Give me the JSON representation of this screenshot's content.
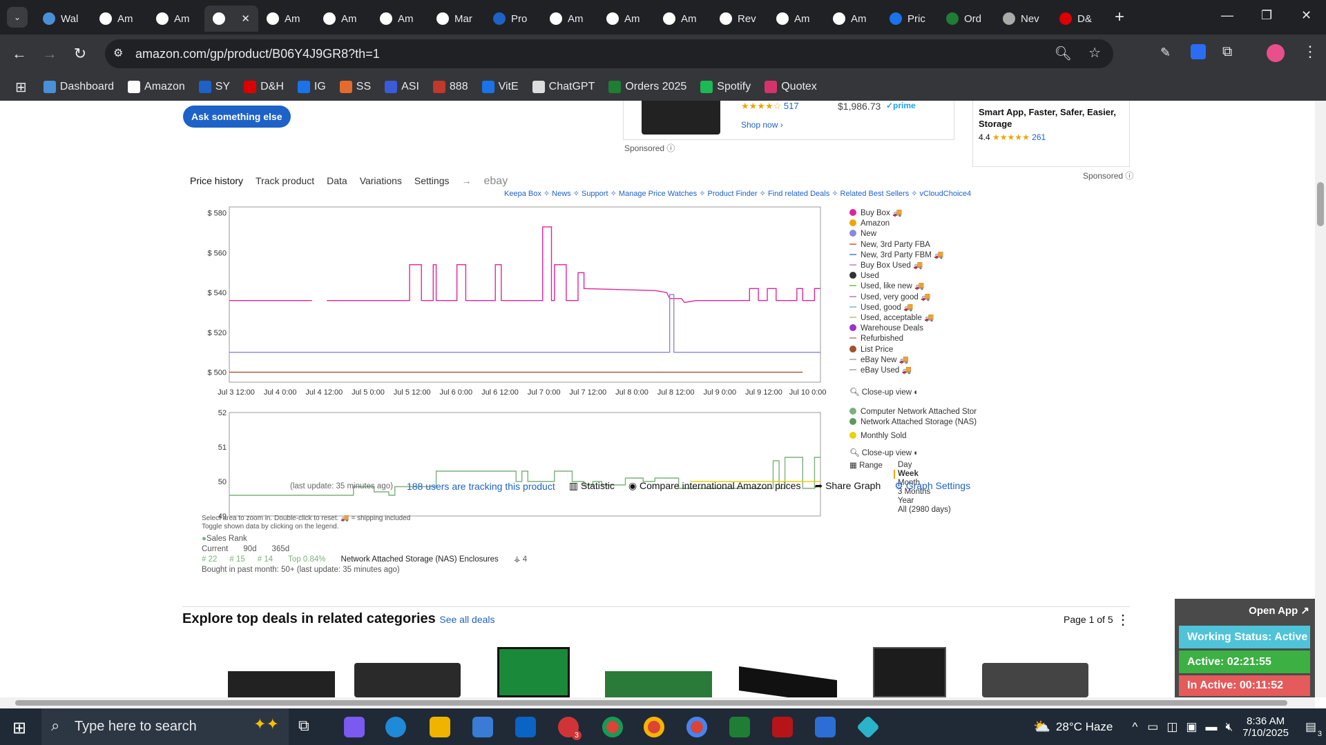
{
  "tabs": [
    {
      "label": "Wal",
      "icon": "walmart-icon",
      "color": "#4a90d9"
    },
    {
      "label": "Am",
      "icon": "amazon-icon",
      "color": "#fff"
    },
    {
      "label": "Am",
      "icon": "amazon-icon",
      "color": "#fff"
    },
    {
      "label": "",
      "icon": "amazon-icon",
      "color": "#fff",
      "active": true
    },
    {
      "label": "Am",
      "icon": "amazon-icon",
      "color": "#fff"
    },
    {
      "label": "Am",
      "icon": "amazon-icon",
      "color": "#fff"
    },
    {
      "label": "Am",
      "icon": "amazon-icon",
      "color": "#fff"
    },
    {
      "label": "Mar",
      "icon": "amazon-icon",
      "color": "#fff"
    },
    {
      "label": "Pro",
      "icon": "ec-icon",
      "color": "#1d62c7"
    },
    {
      "label": "Am",
      "icon": "amazon-icon",
      "color": "#fff"
    },
    {
      "label": "Am",
      "icon": "amazon-icon",
      "color": "#fff"
    },
    {
      "label": "Am",
      "icon": "amazon-icon",
      "color": "#fff"
    },
    {
      "label": "Rev",
      "icon": "amazon-icon",
      "color": "#fff"
    },
    {
      "label": "Am",
      "icon": "amazon-icon",
      "color": "#fff"
    },
    {
      "label": "Am",
      "icon": "amazon-icon",
      "color": "#fff"
    },
    {
      "label": "Pric",
      "icon": "dollar-icon",
      "color": "#1a73e8"
    },
    {
      "label": "Ord",
      "icon": "excel-icon",
      "color": "#1e7e34"
    },
    {
      "label": "Nev",
      "icon": "chrome-icon",
      "color": "#aaa"
    },
    {
      "label": "D&",
      "icon": "dh-icon",
      "color": "#d00"
    }
  ],
  "address": "amazon.com/gp/product/B06Y4J9GR8?th=1",
  "bookmarks": [
    {
      "label": "Dashboard",
      "color": "#4a90d9"
    },
    {
      "label": "Amazon",
      "color": "#fff"
    },
    {
      "label": "SY",
      "color": "#1d62c7"
    },
    {
      "label": "D&H",
      "color": "#d00"
    },
    {
      "label": "IG",
      "color": "#1a73e8"
    },
    {
      "label": "SS",
      "color": "#e36b2c"
    },
    {
      "label": "ASI",
      "color": "#3b5bdb"
    },
    {
      "label": "888",
      "color": "#c0392b"
    },
    {
      "label": "VitE",
      "color": "#1a73e8"
    },
    {
      "label": "ChatGPT",
      "color": "#ddd"
    },
    {
      "label": "Orders 2025",
      "color": "#1e7e34"
    },
    {
      "label": "Spotify",
      "color": "#1db954"
    },
    {
      "label": "Quotex",
      "color": "#d6336c"
    }
  ],
  "page": {
    "ask_button": "Ask something else",
    "ad1_rating_count": "517",
    "ad1_price": "$1,986.73",
    "ad1_prime": "✓prime",
    "ad1_shop": "Shop now ›",
    "sponsored": "Sponsored",
    "ad2_title": "Smart App, Faster, Safer, Easier, Storage",
    "ad2_rating": "4.4",
    "ad2_count": "261",
    "keepa_tabs": [
      "Price history",
      "Track product",
      "Data",
      "Variations",
      "Settings"
    ],
    "arrow": "→",
    "ebay": "ebay",
    "keepa_links": "Keepa Box ✧ News ✧ Support ✧ Manage Price Watches ✧ Product Finder ✧ Find related Deals ✧ Related Best Sellers ✧ vCloudChoice4",
    "price_legend": [
      {
        "label": "Buy Box",
        "kind": "dot",
        "color": "#e0249a",
        "truck": true
      },
      {
        "label": "Amazon",
        "kind": "dot",
        "color": "#f0a500"
      },
      {
        "label": "New",
        "kind": "dot",
        "color": "#8888dd"
      },
      {
        "label": "New, 3rd Party FBA",
        "kind": "line",
        "color": "#e08060"
      },
      {
        "label": "New, 3rd Party FBM",
        "kind": "line",
        "color": "#6aa0e0",
        "truck": true
      },
      {
        "label": "Buy Box Used",
        "kind": "line",
        "color": "#d0a0d0",
        "truck": true
      },
      {
        "label": "Used",
        "kind": "dot",
        "color": "#333"
      },
      {
        "label": "Used, like new",
        "kind": "line",
        "color": "#9c6",
        "truck": true
      },
      {
        "label": "Used, very good",
        "kind": "line",
        "color": "#c9c",
        "truck": true
      },
      {
        "label": "Used, good",
        "kind": "line",
        "color": "#9cc",
        "truck": true
      },
      {
        "label": "Used, acceptable",
        "kind": "line",
        "color": "#cc9",
        "truck": true
      },
      {
        "label": "Warehouse Deals",
        "kind": "dot",
        "color": "#9933cc"
      },
      {
        "label": "Refurbished",
        "kind": "line",
        "color": "#c99"
      },
      {
        "label": "List Price",
        "kind": "dot",
        "color": "#a0522d"
      },
      {
        "label": "eBay New",
        "kind": "line",
        "color": "#bbb",
        "truck": true
      },
      {
        "label": "eBay Used",
        "kind": "line",
        "color": "#bbb",
        "truck": true
      }
    ],
    "closeup": "Close-up view",
    "rank_legend": [
      {
        "label": "Computer Network Attached Stor",
        "color": "#7cb07c"
      },
      {
        "label": "Network Attached Storage (NAS)",
        "color": "#5a9a5a"
      },
      {
        "label": "Monthly Sold",
        "color": "#e8d200"
      }
    ],
    "range_label": "Range",
    "ranges": [
      "Day",
      "Week",
      "Month",
      "3 Months",
      "Year",
      "All (2980 days)"
    ],
    "range_selected": "Week",
    "hint1": "Select area to zoom in. Double-click to reset.",
    "hint_truck": "= shipping included",
    "hint2": "Toggle shown data by clicking on the legend.",
    "sales_rank": "Sales Rank",
    "stats_heads": [
      "Current",
      "90d",
      "365d"
    ],
    "stats_vals": [
      "# 22",
      "# 15",
      "# 14"
    ],
    "top_pct": "Top 0.84%",
    "category": "Network Attached Storage (NAS) Enclosures",
    "cat_count": "4",
    "bought": "Bought in past month: 50+ (last update: 35 minutes ago)",
    "last_update": "(last update: 35 minutes ago)",
    "tracking": "188 users are tracking this product",
    "statistic": "Statistic",
    "compare": "Compare international Amazon prices",
    "share": "Share Graph",
    "graph_settings": "Graph Settings",
    "explore_title": "Explore top deals in related categories",
    "see_all": "See all deals",
    "page_of": "Page 1 of 5"
  },
  "widget": {
    "open_app": "Open App ↗",
    "working": "Working Status: Active",
    "active": "Active: 02:21:55",
    "inactive": "In Active: 00:11:52"
  },
  "taskbar": {
    "search_placeholder": "Type here to search",
    "weather": "28°C  Haze",
    "time": "8:36 AM",
    "date": "7/10/2025",
    "notif_count": "3",
    "outlook_badge": "3"
  },
  "chart_data": [
    {
      "type": "line",
      "title": "",
      "x_ticks": [
        "Jul 3 12:00",
        "Jul 4 0:00",
        "Jul 4 12:00",
        "Jul 5 0:00",
        "Jul 5 12:00",
        "Jul 6 0:00",
        "Jul 6 12:00",
        "Jul 7 0:00",
        "Jul 7 12:00",
        "Jul 8 0:00",
        "Jul 8 12:00",
        "Jul 9 0:00",
        "Jul 9 12:00",
        "Jul 10 0:00"
      ],
      "y_ticks": [
        "$ 580",
        "$ 560",
        "$ 540",
        "$ 520",
        "$ 500"
      ],
      "ylim": [
        495,
        583
      ],
      "xlim": [
        0,
        100
      ],
      "series": [
        {
          "name": "Buy Box",
          "color": "#e0249a",
          "points": [
            [
              0,
              536
            ],
            [
              14,
              536
            ],
            [
              14.5,
              null
            ],
            [
              16.5,
              536
            ],
            [
              30.5,
              536
            ],
            [
              30.5,
              554
            ],
            [
              32.5,
              554
            ],
            [
              32.5,
              536
            ],
            [
              34.5,
              536
            ],
            [
              34.5,
              554
            ],
            [
              35,
              554
            ],
            [
              35,
              536
            ],
            [
              38.5,
              536
            ],
            [
              38.5,
              554
            ],
            [
              40,
              554
            ],
            [
              40,
              536
            ],
            [
              45,
              536
            ],
            [
              45,
              554
            ],
            [
              46,
              554
            ],
            [
              46,
              536
            ],
            [
              53,
              536
            ],
            [
              53,
              573
            ],
            [
              54.5,
              573
            ],
            [
              54.5,
              536
            ],
            [
              55,
              536
            ],
            [
              55,
              554
            ],
            [
              57,
              554
            ],
            [
              57,
              536
            ],
            [
              59,
              536
            ],
            [
              59,
              550
            ],
            [
              60,
              550
            ],
            [
              60,
              542
            ],
            [
              72,
              541
            ],
            [
              74,
              540
            ],
            [
              74.5,
              537
            ],
            [
              76.5,
              537
            ],
            [
              77,
              535
            ],
            [
              79,
              536
            ],
            [
              88,
              536
            ],
            [
              88,
              542
            ],
            [
              89.5,
              542
            ],
            [
              89.5,
              536
            ],
            [
              91,
              536
            ],
            [
              91,
              542
            ],
            [
              92.5,
              542
            ],
            [
              92.5,
              536
            ],
            [
              96,
              536
            ],
            [
              96,
              542
            ],
            [
              97,
              542
            ],
            [
              97,
              536
            ],
            [
              99,
              536
            ],
            [
              99,
              542
            ],
            [
              100,
              542
            ]
          ]
        },
        {
          "name": "New",
          "color": "#8888dd",
          "points": [
            [
              0,
              510
            ],
            [
              74.5,
              510
            ],
            [
              74.5,
              539
            ],
            [
              75.2,
              539
            ],
            [
              75.2,
              510
            ],
            [
              100,
              510
            ]
          ]
        },
        {
          "name": "List Price",
          "color": "#a0522d",
          "points": [
            [
              0,
              500
            ],
            [
              97,
              500
            ]
          ]
        }
      ]
    },
    {
      "type": "line",
      "title": "",
      "y_ticks": [
        "52",
        "51",
        "50",
        "49"
      ],
      "ylim": [
        49,
        52
      ],
      "xlim": [
        0,
        100
      ],
      "series": [
        {
          "name": "Network Attached Storage (NAS)",
          "color": "#7cb07c",
          "points": [
            [
              0,
              49.6
            ],
            [
              21,
              49.6
            ],
            [
              21,
              49.85
            ],
            [
              24.5,
              49.85
            ],
            [
              24.5,
              49.7
            ],
            [
              27,
              49.7
            ],
            [
              27,
              49.6
            ],
            [
              28,
              49.6
            ],
            [
              28,
              49.85
            ],
            [
              35,
              49.85
            ],
            [
              35,
              50.3
            ],
            [
              48.5,
              50.3
            ],
            [
              48.5,
              50
            ],
            [
              49.5,
              50
            ],
            [
              49.5,
              50.3
            ],
            [
              50.5,
              50.3
            ],
            [
              50.5,
              50
            ],
            [
              55,
              50
            ],
            [
              55,
              50.3
            ],
            [
              58,
              50.3
            ],
            [
              58,
              50
            ],
            [
              60,
              50
            ],
            [
              60,
              49.9
            ],
            [
              61.5,
              49.9
            ],
            [
              61.5,
              50
            ],
            [
              63,
              50
            ],
            [
              63,
              49.9
            ],
            [
              67,
              49.9
            ],
            [
              67,
              50.1
            ],
            [
              70,
              50.1
            ],
            [
              70,
              50
            ],
            [
              72,
              50
            ],
            [
              72,
              50.1
            ],
            [
              76,
              50.1
            ],
            [
              76,
              49.8
            ],
            [
              92,
              49.8
            ],
            [
              92,
              50.6
            ],
            [
              93,
              50.6
            ],
            [
              93,
              49.8
            ],
            [
              94,
              49.8
            ],
            [
              94,
              50.7
            ],
            [
              97,
              50.7
            ],
            [
              97,
              49.8
            ],
            [
              99,
              49.8
            ],
            [
              99,
              50.7
            ],
            [
              100,
              50.7
            ]
          ]
        },
        {
          "name": "Monthly Sold",
          "color": "#e8d200",
          "points": [
            [
              78,
              50
            ],
            [
              100,
              50
            ]
          ]
        }
      ]
    }
  ]
}
